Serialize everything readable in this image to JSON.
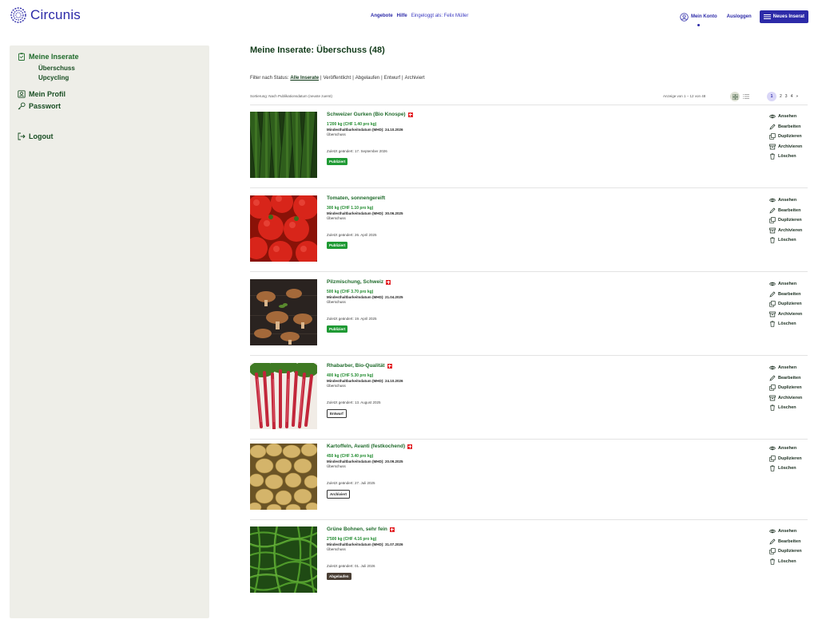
{
  "header": {
    "logo_text": "Circunis",
    "nav": {
      "offers": "Angebote",
      "help": "Hilfe",
      "logged_in": "Eingeloggt als: Felix Müller"
    },
    "account": "Mein Konto",
    "logout": "Ausloggen",
    "new_listing": "Neues Inserat"
  },
  "sidebar": {
    "listings_title": "Meine Inserate",
    "sub_surplus": "Überschuss",
    "sub_upcycling": "Upcycling",
    "profile": "Mein Profil",
    "password": "Passwort",
    "logout": "Logout"
  },
  "main": {
    "title": "Meine Inserate: Überschuss (48)",
    "filter_label": "Filter nach Status:",
    "filters": [
      "Alle Inserate",
      "Veröffentlicht",
      "Abgelaufen",
      "Entwurf",
      "Archiviert"
    ],
    "sort": "Sortierung: Nach Publikationsdatum (neuste zuerst)",
    "range": "Anzeige von 1 – 12 von 48",
    "pages": [
      "1",
      "2",
      "3",
      "4",
      "»"
    ]
  },
  "actions": {
    "view": "Ansehen",
    "edit": "Bearbeiten",
    "duplicate": "Duplizieren",
    "archive": "Archivieren",
    "delete": "Löschen"
  },
  "listings": [
    {
      "name": "Schweizer Gurken (Bio Knospe)",
      "qty": "1'200 kg  (CHF 1.40 pro kg)",
      "mhd": "Mindesthaltbarkeitsdatum (MHD): 24.10.2026",
      "category": "Überschuss",
      "changed": "Zuletzt geändert: 17. September 2026",
      "status": "Publiziert"
    },
    {
      "name": "Tomaten, sonnengereift",
      "qty": "300 kg  (CHF 1.10 pro kg)",
      "mhd": "Mindesthaltbarkeitsdatum (MHD): 30.06.2025",
      "category": "Überschuss",
      "changed": "Zuletzt geändert: 26. April 2025",
      "status": "Publiziert"
    },
    {
      "name": "Pilzmischung, Schweiz",
      "qty": "500 kg  (CHF 3.70 pro kg)",
      "mhd": "Mindesthaltbarkeitsdatum (MHD): 21.04.2025",
      "category": "Überschuss",
      "changed": "Zuletzt geändert: 19. April 2025",
      "status": "Publiziert"
    },
    {
      "name": "Rhabarber, Bio-Qualität",
      "qty": "400 kg  (CHF 5.30 pro kg)",
      "mhd": "Mindesthaltbarkeitsdatum (MHD): 24.10.2026",
      "category": "Überschuss",
      "changed": "Zuletzt geändert: 13. August 2025",
      "status": "Entwurf"
    },
    {
      "name": "Kartoffeln, Avanti (festkochend)",
      "qty": "450 kg  (CHF 3.40 pro kg)",
      "mhd": "Mindesthaltbarkeitsdatum (MHD): 20.09.2025",
      "category": "Überschuss",
      "changed": "Zuletzt geändert: 27. Juli 2025",
      "status": "Archiviert"
    },
    {
      "name": "Grüne Bohnen, sehr fein",
      "qty": "2'500 kg  (CHF 4.16 pro kg)",
      "mhd": "Mindesthaltbarkeitsdatum (MHD): 31.07.2026",
      "category": "Überschuss",
      "changed": "Zuletzt geändert: 01. Juli 2026",
      "status": "Abgelaufen"
    }
  ],
  "colors": {
    "brand": "#2c2aa8",
    "green_title": "#1f6b2b",
    "published": "#1f9a34",
    "expired": "#4a3f35",
    "sidebar_bg": "#eeeee8"
  }
}
